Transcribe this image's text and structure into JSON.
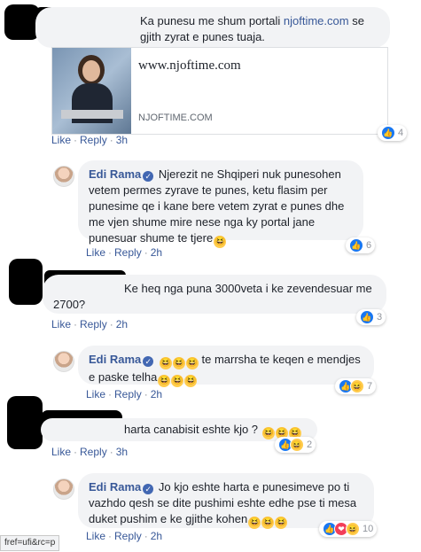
{
  "actions": {
    "like": "Like",
    "reply": "Reply",
    "separator": "·"
  },
  "comments": [
    {
      "text_before_link": "Ka punesu me shum portali ",
      "link": "njoftime.com",
      "text_after_link": " se gjith zyrat e punes tuaja.",
      "preview": {
        "url": "www.njoftime.com",
        "domain": "NJOFTIME.COM"
      },
      "time": "3h",
      "reactions": {
        "icons": [
          "like-icon"
        ],
        "count": "4"
      }
    },
    {
      "author": "Edi Rama",
      "text": "Njerezit ne Shqiperi nuk punesohen vetem permes zyrave te punes, ketu flasim per punesime qe i kane bere vetem zyrat e punes dhe me vjen shume mire nese nga ky portal jane punesuar shume te tjere",
      "emoji_count": 1,
      "time": "2h",
      "reactions": {
        "icons": [
          "like-icon"
        ],
        "count": "6"
      }
    },
    {
      "line1": "Ke heq nga puna 3000veta i ke zevendesuar me",
      "line2": "2700?",
      "time": "2h",
      "reactions": {
        "icons": [
          "like-icon"
        ],
        "count": "3"
      }
    },
    {
      "author": "Edi Rama",
      "text_mid": "te marrsha te keqen e mendjes",
      "text_line2": "e paske telha",
      "time": "2h",
      "reactions": {
        "icons": [
          "like-icon",
          "haha-icon"
        ],
        "count": "7"
      }
    },
    {
      "text": "harta canabisit eshte kjo ?",
      "time": "3h",
      "reactions": {
        "icons": [
          "like-icon",
          "haha-icon"
        ],
        "count": "2"
      }
    },
    {
      "author": "Edi Rama",
      "line1": "Jo kjo eshte harta e punesimeve po ti",
      "line2": "vazhdo qesh se dite pushimi eshte edhe pse ti mesa",
      "line3": "duket pushim e ke gjithe kohen",
      "time": "2h",
      "reactions": {
        "icons": [
          "like-icon",
          "love-icon",
          "haha-icon"
        ],
        "count": "10"
      }
    }
  ],
  "status_url": "fref=ufi&rc=p",
  "colors": {
    "link": "#385898",
    "bubble": "#f2f3f5",
    "like": "#1877f2",
    "love": "#f33e58",
    "haha": "#ffcc4d"
  }
}
